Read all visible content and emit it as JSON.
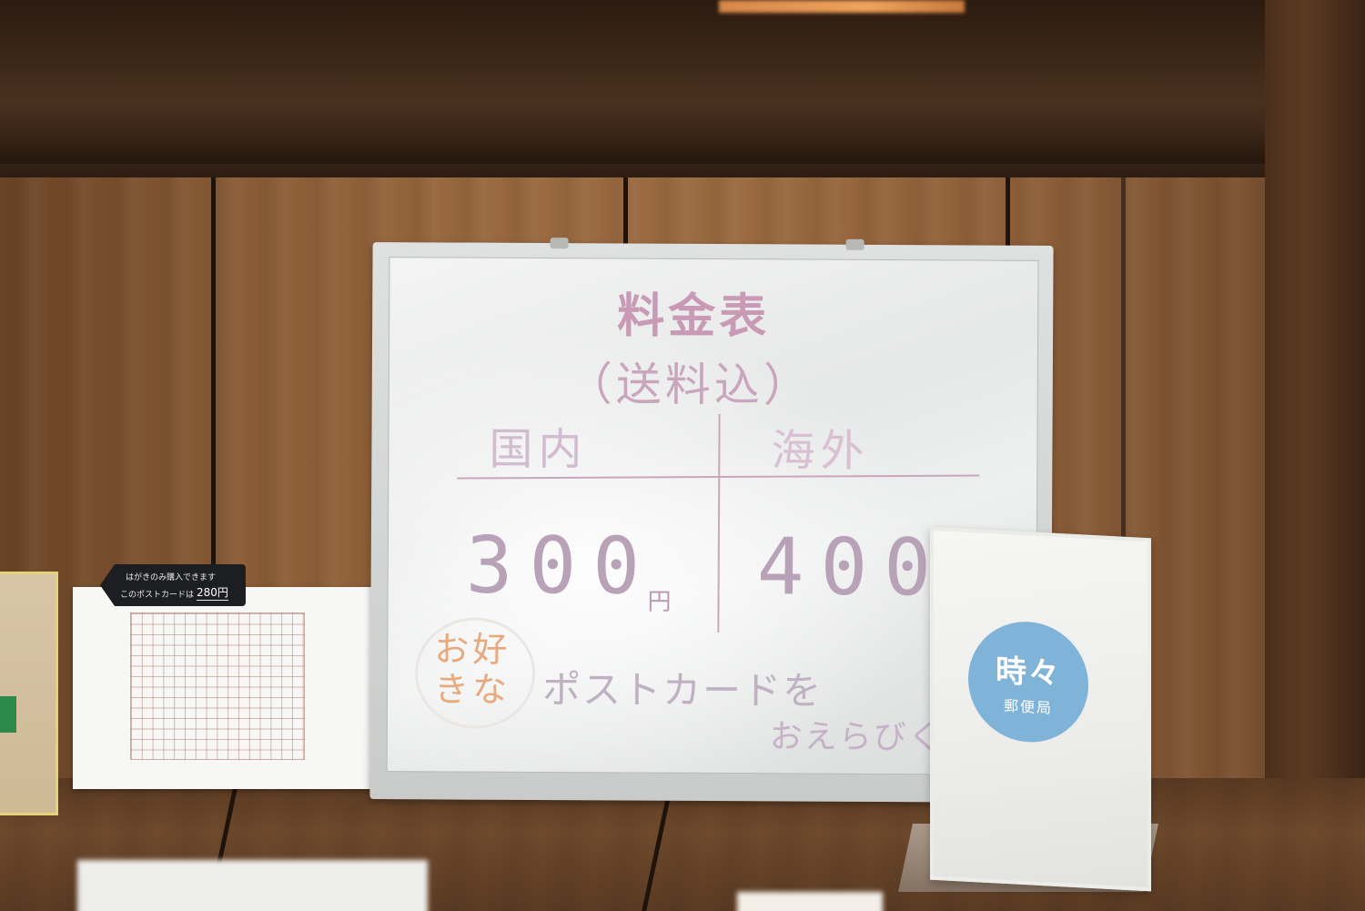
{
  "whiteboard": {
    "title": "料金表",
    "subtitle": "（送料込）",
    "col_domestic": "国内",
    "col_overseas": "海外",
    "price_domestic": "300",
    "price_overseas": "400",
    "yen": "円",
    "bubble_text": "お好きな",
    "postcard_text": "ポストカードを",
    "choose_text": "おえらびく"
  },
  "price_tag": {
    "line1": "はがきのみ購入できます",
    "line2": "このポストカードは",
    "price": "280円"
  },
  "sign": {
    "logo_main": "時々",
    "logo_sub": "郵便局",
    "logo_color": "#7fb3d8"
  }
}
